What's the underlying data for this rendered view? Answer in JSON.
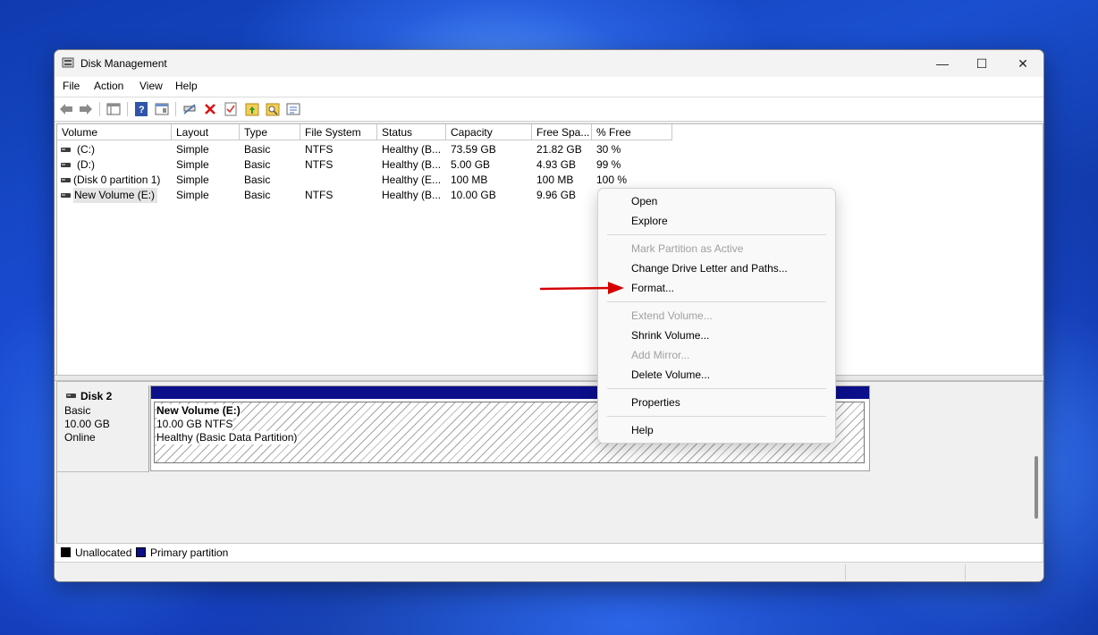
{
  "window": {
    "title": "Disk Management",
    "minimize_icon": "—",
    "maximize_icon": "☐",
    "close_icon": "✕"
  },
  "menu": [
    "File",
    "Action",
    "View",
    "Help"
  ],
  "toolbar_icons": [
    "back-arrow-icon",
    "forward-arrow-icon",
    "console-tree-icon",
    "help-icon",
    "properties-icon",
    "connect-icon",
    "delete-icon",
    "checklist-icon",
    "folder-up-icon",
    "folder-search-icon",
    "settings-panel-icon"
  ],
  "volume_table": {
    "headers": [
      "Volume",
      "Layout",
      "Type",
      "File System",
      "Status",
      "Capacity",
      "Free Spa...",
      "% Free"
    ],
    "rows": [
      [
        "(C:)",
        "Simple",
        "Basic",
        "NTFS",
        "Healthy (B...",
        "73.59 GB",
        "21.82 GB",
        "30 %"
      ],
      [
        "(D:)",
        "Simple",
        "Basic",
        "NTFS",
        "Healthy (B...",
        "5.00 GB",
        "4.93 GB",
        "99 %"
      ],
      [
        "(Disk 0 partition 1)",
        "Simple",
        "Basic",
        "",
        "Healthy (E...",
        "100 MB",
        "100 MB",
        "100 %"
      ],
      [
        "New Volume (E:)",
        "Simple",
        "Basic",
        "NTFS",
        "Healthy (B...",
        "10.00 GB",
        "9.96 GB",
        ""
      ]
    ]
  },
  "disk": {
    "name": "Disk 2",
    "type": "Basic",
    "size": "10.00 GB",
    "state": "Online",
    "partition": {
      "name": "New Volume  (E:)",
      "size_fs": "10.00 GB NTFS",
      "status": "Healthy (Basic Data Partition)"
    }
  },
  "legend": {
    "unallocated": "Unallocated",
    "primary": "Primary partition",
    "unallocated_color": "#000000",
    "primary_color": "#0b0f8a"
  },
  "context_menu": {
    "open": "Open",
    "explore": "Explore",
    "mark_active": "Mark Partition as Active",
    "change_letter": "Change Drive Letter and Paths...",
    "format": "Format...",
    "extend": "Extend Volume...",
    "shrink": "Shrink Volume...",
    "add_mirror": "Add Mirror...",
    "delete": "Delete Volume...",
    "properties": "Properties",
    "help": "Help"
  },
  "accent_arrow_color": "#d40000"
}
